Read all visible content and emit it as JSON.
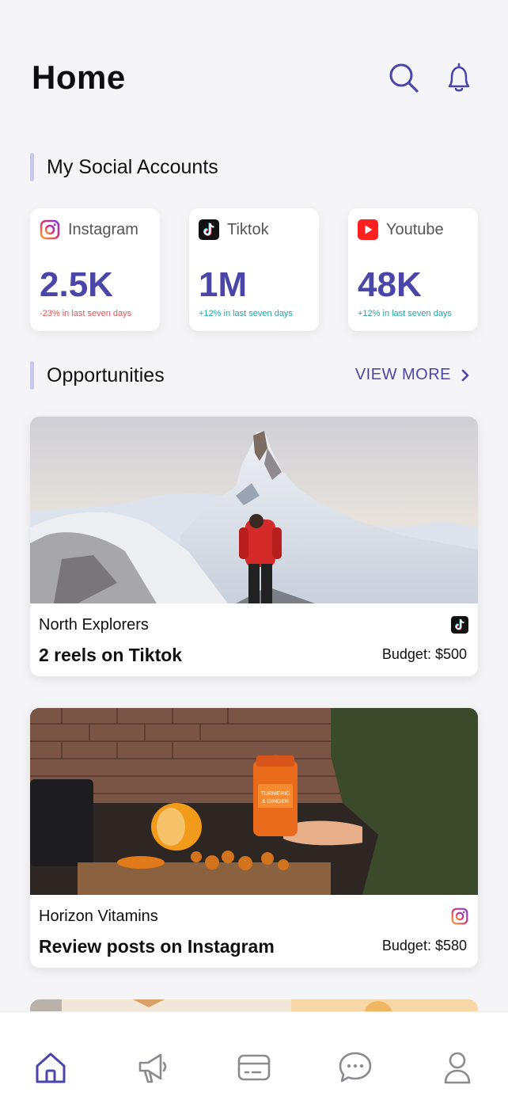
{
  "header": {
    "title": "Home"
  },
  "social": {
    "section_title": "My Social Accounts",
    "accounts": [
      {
        "name": "Instagram",
        "value": "2.5K",
        "delta": "-23% in last seven days",
        "icon": "instagram-icon"
      },
      {
        "name": "Tiktok",
        "value": "1M",
        "delta": "+12% in last seven days",
        "icon": "tiktok-icon"
      },
      {
        "name": "Youtube",
        "value": "48K",
        "delta": "+12% in last seven days",
        "icon": "youtube-icon"
      }
    ]
  },
  "opportunities": {
    "section_title": "Opportunities",
    "view_more": "VIEW MORE",
    "items": [
      {
        "brand": "North Explorers",
        "title": "2 reels on Tiktok",
        "budget": "Budget: $500",
        "platform": "tiktok-icon"
      },
      {
        "brand": "Horizon Vitamins",
        "title": "Review posts on Instagram",
        "budget": "Budget: $580",
        "platform": "instagram-icon"
      }
    ]
  },
  "tabbar": {
    "tabs": [
      {
        "name": "home",
        "icon": "home-icon",
        "active": true
      },
      {
        "name": "campaigns",
        "icon": "megaphone-icon",
        "active": false
      },
      {
        "name": "payments",
        "icon": "card-icon",
        "active": false
      },
      {
        "name": "messages",
        "icon": "chat-icon",
        "active": false
      },
      {
        "name": "profile",
        "icon": "user-icon",
        "active": false
      }
    ]
  },
  "colors": {
    "accent": "#4a45a8",
    "negative": "#e05656",
    "positive": "#1fa8a3",
    "section_bar": "#c9c7ee",
    "background": "#f5f5f7"
  }
}
